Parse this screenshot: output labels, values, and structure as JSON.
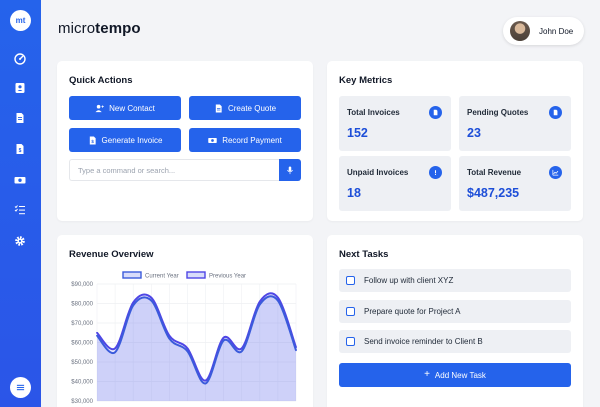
{
  "app": {
    "logo_text": "mt",
    "brand_light": "micro",
    "brand_bold": "tempo"
  },
  "user": {
    "name": "John Doe"
  },
  "sidebar": {
    "items": [
      {
        "icon": "dashboard-icon"
      },
      {
        "icon": "contacts-icon"
      },
      {
        "icon": "invoice-icon"
      },
      {
        "icon": "quote-icon"
      },
      {
        "icon": "payments-icon"
      },
      {
        "icon": "tasks-icon"
      },
      {
        "icon": "settings-icon"
      }
    ],
    "menu_icon": "menu-icon"
  },
  "quick_actions": {
    "title": "Quick Actions",
    "buttons": [
      {
        "label": "New Contact",
        "icon": "user-plus-icon"
      },
      {
        "label": "Create Quote",
        "icon": "document-icon"
      },
      {
        "label": "Generate Invoice",
        "icon": "invoice-icon"
      },
      {
        "label": "Record Payment",
        "icon": "money-icon"
      }
    ],
    "command_placeholder": "Type a command or search...",
    "mic_icon": "microphone-icon"
  },
  "metrics": {
    "title": "Key Metrics",
    "items": [
      {
        "label": "Total Invoices",
        "value": "152",
        "icon": "file-icon"
      },
      {
        "label": "Pending Quotes",
        "value": "23",
        "icon": "file-icon"
      },
      {
        "label": "Unpaid Invoices",
        "value": "18",
        "icon": "alert-icon"
      },
      {
        "label": "Total Revenue",
        "value": "$487,235",
        "icon": "chart-line-icon"
      }
    ]
  },
  "revenue": {
    "title": "Revenue Overview"
  },
  "tasks": {
    "title": "Next Tasks",
    "items": [
      {
        "text": "Follow up with client XYZ",
        "checked": false
      },
      {
        "text": "Prepare quote for Project A",
        "checked": false
      },
      {
        "text": "Send invoice reminder to Client B",
        "checked": false
      }
    ],
    "add_label": "Add New Task"
  },
  "colors": {
    "accent": "#2563eb",
    "metric_value": "#1d4ed8",
    "card_bg": "#ffffff",
    "page_bg": "#f3f4f7"
  },
  "chart_data": {
    "type": "area",
    "ylim": [
      30000,
      90000
    ],
    "y_ticks": [
      "$90,000",
      "$80,000",
      "$70,000",
      "$60,000",
      "$50,000",
      "$40,000",
      "$30,000"
    ],
    "y_tick_values": [
      90000,
      80000,
      70000,
      60000,
      50000,
      40000,
      30000
    ],
    "grid": true,
    "legend_position": "top",
    "series": [
      {
        "name": "Current Year",
        "color": "#3b5bdb",
        "values": [
          63500,
          55000,
          79000,
          81500,
          62000,
          55500,
          39000,
          61000,
          55500,
          79500,
          81500,
          56000
        ]
      },
      {
        "name": "Previous Year",
        "color": "#4f46e5",
        "values": [
          65000,
          57000,
          80500,
          83000,
          63500,
          57000,
          40500,
          62500,
          57000,
          81000,
          83000,
          57500
        ]
      }
    ]
  }
}
